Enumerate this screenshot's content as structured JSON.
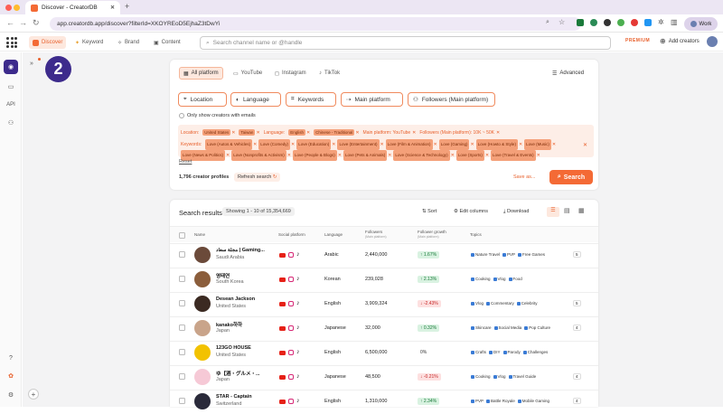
{
  "browser": {
    "tab_title": "Discover - CreatorDB",
    "url": "app.creatordb.app/discover?filterId=XKOYREoD5EjhaZ3tDwYi",
    "profile": "Work"
  },
  "nav": {
    "tabs": [
      "Discover",
      "Keyword",
      "Brand",
      "Content"
    ],
    "search_placeholder": "Search channel name or @handle",
    "premium": "PREMIUM",
    "add_creators": "Add creators"
  },
  "sidebar": {
    "api": "API"
  },
  "step_badge": "2",
  "platforms": [
    "All platform",
    "YouTube",
    "Instagram",
    "TikTok"
  ],
  "advanced": "Advanced",
  "filters": [
    "Location",
    "Language",
    "Keywords",
    "Main platform",
    "Followers (Main platform)"
  ],
  "email_only": "Only show creators with emails",
  "active": {
    "location_label": "Location:",
    "location": [
      "United States",
      "Taiwan"
    ],
    "language_label": "Language:",
    "language": [
      "English",
      "Chinese - Traditional"
    ],
    "main_platform": "Main platform: YouTube",
    "followers": "Followers (Main platform): 10K ~ 50K",
    "keywords_label": "Keywords:",
    "keywords": [
      "Love (Autos & Vehicles)",
      "Love (Comedy)",
      "Love (Education)",
      "Love (Entertainment)",
      "Love (Film & Animation)",
      "Love (Gaming)",
      "Love (Howto & Style)",
      "Love (Music)",
      "Love (News & Politics)",
      "Love (Nonprofits & Activism)",
      "Love (People & Blogs)",
      "Love (Pets & Animals)",
      "Love (Science & Technology)",
      "Love (Sports)",
      "Love (Travel & Events)"
    ]
  },
  "reset": "Reset",
  "profiles_count": "1,796 creator profiles",
  "refresh": "Refresh search",
  "save_as": "Save as...",
  "search_btn": "Search",
  "results": {
    "title": "Search results",
    "showing": "Showing 1 - 10 of 15,354,669",
    "sort": "Sort",
    "edit_columns": "Edit columns",
    "download": "Download"
  },
  "columns": {
    "name": "Name",
    "social": "Social platform",
    "language": "Language",
    "followers": "Followers",
    "followers_sub": "(Main platform)",
    "growth": "Follower growth",
    "growth_sub": "(Main platform)",
    "topics": "Topics"
  },
  "rows": [
    {
      "name": "مجلة سعاد | Gaming...",
      "country": "Saudi Arabia",
      "language": "Arabic",
      "followers": "2,440,000",
      "growth": "↑ 1.67%",
      "gtype": "up",
      "topics": [
        "Nature Travel",
        "PVP",
        "Free Games"
      ],
      "more": "5",
      "avatar": "#6b4a3a"
    },
    {
      "name": "영태연",
      "country": "South Korea",
      "language": "Korean",
      "followers": "239,028",
      "growth": "↑ 2.13%",
      "gtype": "up",
      "topics": [
        "Cooking",
        "Vlog",
        "Food"
      ],
      "more": "",
      "avatar": "#8b5e3c"
    },
    {
      "name": "Desean Jackson",
      "country": "United States",
      "language": "English",
      "followers": "3,909,324",
      "growth": "↓ -2.43%",
      "gtype": "down",
      "topics": [
        "Vlog",
        "Commentary",
        "Celebrity"
      ],
      "more": "5",
      "avatar": "#3b2a22"
    },
    {
      "name": "kanako하하",
      "country": "Japan",
      "language": "Japanese",
      "followers": "32,000",
      "growth": "↑ 0.32%",
      "gtype": "up",
      "topics": [
        "Skincare",
        "Social Media",
        "Pop Culture"
      ],
      "more": "4",
      "avatar": "#c9a48a"
    },
    {
      "name": "123GO HOUSE",
      "country": "United States",
      "language": "English",
      "followers": "6,500,000",
      "growth": "0%",
      "gtype": "zero",
      "topics": [
        "Crafts",
        "DIY",
        "Parody",
        "Challenges"
      ],
      "more": "",
      "avatar": "#f2c200"
    },
    {
      "name": "ゆ【酒・グルメ・...",
      "country": "Japan",
      "language": "Japanese",
      "followers": "48,500",
      "growth": "↓ -0.21%",
      "gtype": "down",
      "topics": [
        "Cooking",
        "Vlog",
        "Travel Guide"
      ],
      "more": "4",
      "avatar": "#f6c9d6"
    },
    {
      "name": "STAR - Captain",
      "country": "Switzerland",
      "language": "English",
      "followers": "1,310,000",
      "growth": "↑ 2.34%",
      "gtype": "up",
      "topics": [
        "PVP",
        "Battle Royale",
        "Mobile Gaming"
      ],
      "more": "4",
      "avatar": "#2a2a3a"
    }
  ]
}
